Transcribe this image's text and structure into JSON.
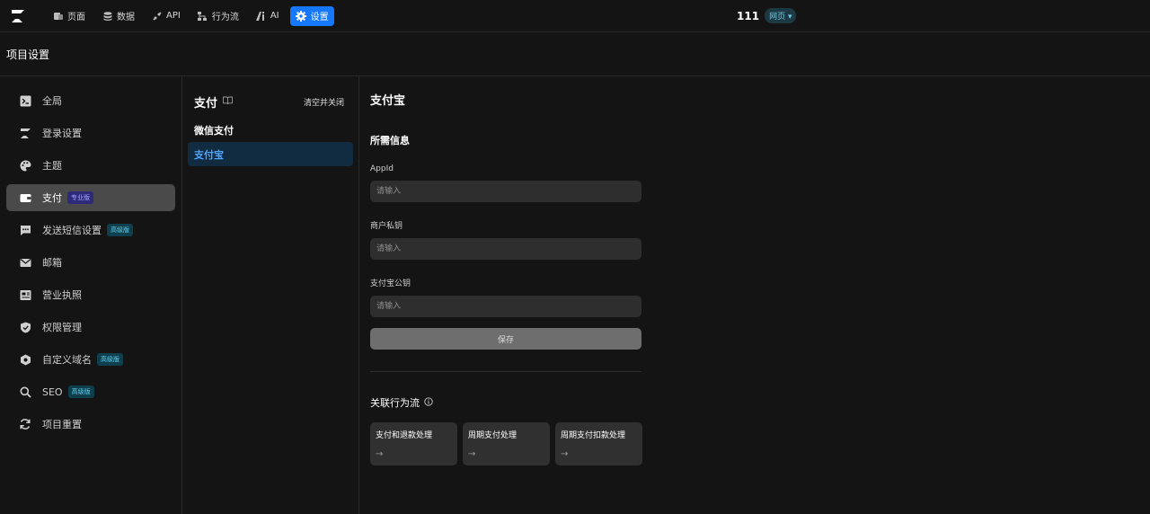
{
  "topbar": {
    "logo_icon": "z-logo-icon",
    "nav": [
      {
        "label": "页面",
        "icon": "page-icon"
      },
      {
        "label": "数据",
        "icon": "database-icon"
      },
      {
        "label": "API",
        "icon": "api-icon"
      },
      {
        "label": "行为流",
        "icon": "flow-icon"
      },
      {
        "label": "AI",
        "icon": "ai-icon"
      },
      {
        "label": "设置",
        "icon": "gear-icon",
        "active": true
      }
    ],
    "project_name": "111",
    "project_type": "网页"
  },
  "page_title": "项目设置",
  "sidebar": {
    "items": [
      {
        "label": "全局",
        "icon": "terminal-icon"
      },
      {
        "label": "登录设置",
        "icon": "login-icon"
      },
      {
        "label": "主题",
        "icon": "palette-icon"
      },
      {
        "label": "支付",
        "icon": "wallet-icon",
        "tag": "专业版",
        "active": true
      },
      {
        "label": "发送短信设置",
        "icon": "sms-icon",
        "tag": "高级版"
      },
      {
        "label": "邮箱",
        "icon": "mail-icon"
      },
      {
        "label": "营业执照",
        "icon": "license-icon"
      },
      {
        "label": "权限管理",
        "icon": "shield-icon"
      },
      {
        "label": "自定义域名",
        "icon": "domain-icon",
        "tag": "高级版"
      },
      {
        "label": "SEO",
        "icon": "search-icon",
        "tag": "高级版"
      },
      {
        "label": "项目重置",
        "icon": "reset-icon"
      }
    ]
  },
  "payment": {
    "title": "支付",
    "clear_close": "清空并关闭",
    "methods": [
      "微信支付",
      "支付宝"
    ]
  },
  "alipay": {
    "title": "支付宝",
    "section": "所需信息",
    "fields": [
      {
        "label": "AppId",
        "placeholder": "请输入"
      },
      {
        "label": "商户私钥",
        "placeholder": "请输入"
      },
      {
        "label": "支付宝公钥",
        "placeholder": "请输入"
      }
    ],
    "save": "保存",
    "flows_title": "关联行为流",
    "flows": [
      "支付和退款处理",
      "周期支付处理",
      "周期支付扣款处理"
    ],
    "flow_arrow": "→"
  },
  "colors": {
    "accent": "#1677ff",
    "active_mid_bg": "#112b40",
    "active_mid_text": "#4ea5ff"
  }
}
